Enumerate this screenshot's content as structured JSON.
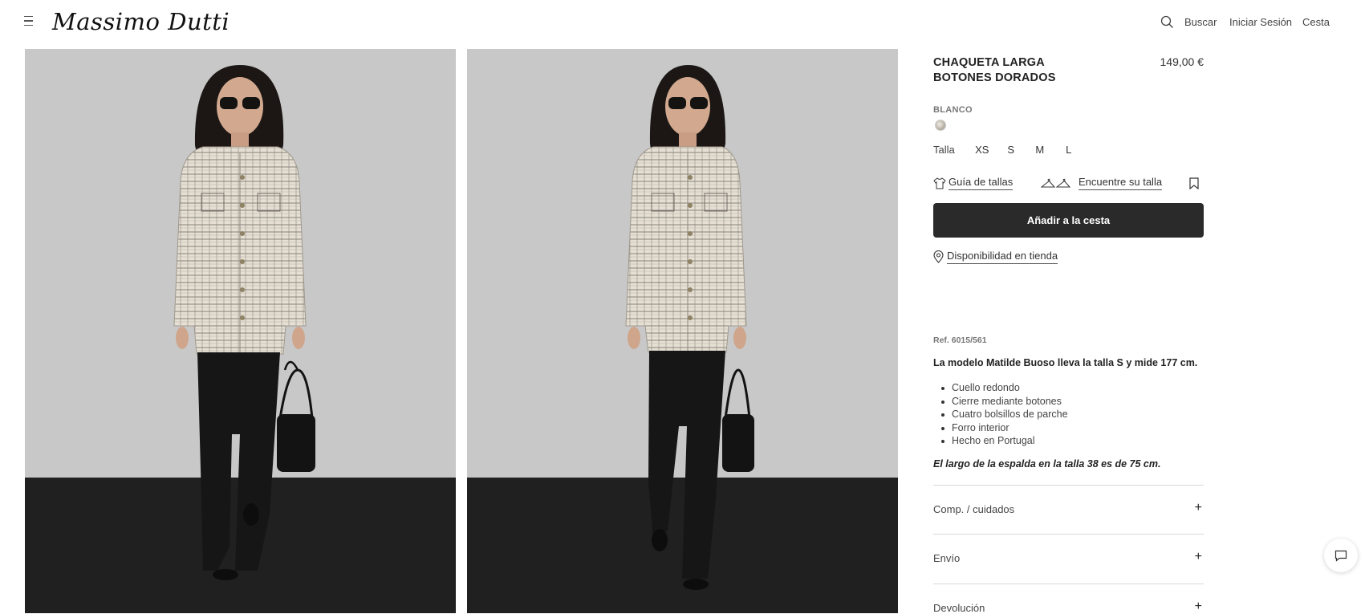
{
  "header": {
    "logo": "Massimo Dutti",
    "search_label": "Buscar",
    "login_label": "Iniciar Sesión",
    "cart_label": "Cesta",
    "icons": [
      "menu-icon",
      "search-icon"
    ]
  },
  "gallery": {
    "images": [
      "product-photo-front",
      "product-photo-side"
    ]
  },
  "product": {
    "title_line1": "CHAQUETA LARGA",
    "title_line2": "BOTONES DORADOS",
    "price": "149,00 €",
    "color_name": "BLANCO",
    "size_label": "Talla",
    "sizes": [
      "XS",
      "S",
      "M",
      "L"
    ],
    "size_guide": "Guía de tallas",
    "size_finder": "Encuentre su talla",
    "add_to_cart": "Añadir a la cesta",
    "store_availability": "Disponibilidad en tienda",
    "ref": "Ref. 6015/561",
    "model_info": "La modelo Matilde Buoso lleva la talla S y mide 177 cm.",
    "features": [
      "Cuello redondo",
      "Cierre mediante botones",
      "Cuatro bolsillos de parche",
      "Forro interior",
      "Hecho en Portugal"
    ],
    "length_note": "El largo de la espalda en la talla 38 es de 75 cm."
  },
  "accordions": [
    {
      "label": "Comp. / cuidados",
      "icon": "+"
    },
    {
      "label": "Envío",
      "icon": "+"
    },
    {
      "label": "Devolución",
      "icon": "+"
    }
  ],
  "colors": {
    "button_bg": "#2a2a2a",
    "backdrop": "#c8c8c9",
    "floor": "#202021"
  }
}
